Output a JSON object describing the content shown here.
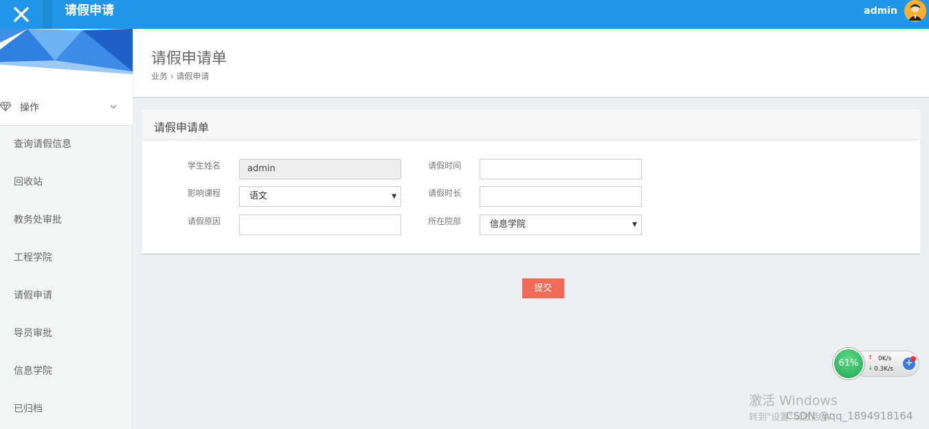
{
  "topbar": {
    "title": "请假申请",
    "user": "admin",
    "close_icon": "close-icon",
    "avatar_icon": "user-avatar"
  },
  "sidebar": {
    "section": {
      "label": "操作",
      "icon": "diamond-icon",
      "chevron": "chevron-down-icon"
    },
    "items": [
      {
        "label": "查询请假信息"
      },
      {
        "label": "回收站"
      },
      {
        "label": "教务处审批"
      },
      {
        "label": "工程学院"
      },
      {
        "label": "请假申请"
      },
      {
        "label": "导员审批"
      },
      {
        "label": "信息学院"
      },
      {
        "label": "已归档"
      }
    ]
  },
  "header": {
    "title": "请假申请单",
    "breadcrumb": "业务 › 请假申请"
  },
  "form": {
    "panel_title": "请假申请单",
    "student_name_label": "学生姓名",
    "student_name_value": "admin",
    "course_label": "影响课程",
    "course_value": "语文",
    "reason_label": "请假原因",
    "reason_value": "",
    "leave_time_label": "请假时间",
    "leave_time_value": "",
    "duration_label": "请假时长",
    "duration_value": "",
    "college_label": "所在院部",
    "college_value": "信息学院",
    "submit_label": "提交"
  },
  "speed_widget": {
    "percent": "61%",
    "upload": "0K/s",
    "download": "0.3K/s"
  },
  "watermarks": {
    "windows_line1": "激活 Windows",
    "windows_line2": "转到\"设置\"以激活 W",
    "csdn": "CSDN @qq_1894918164"
  },
  "colors": {
    "topbar": "#2196e8",
    "submit": "#f16a5a",
    "background": "#ecf0f1"
  }
}
